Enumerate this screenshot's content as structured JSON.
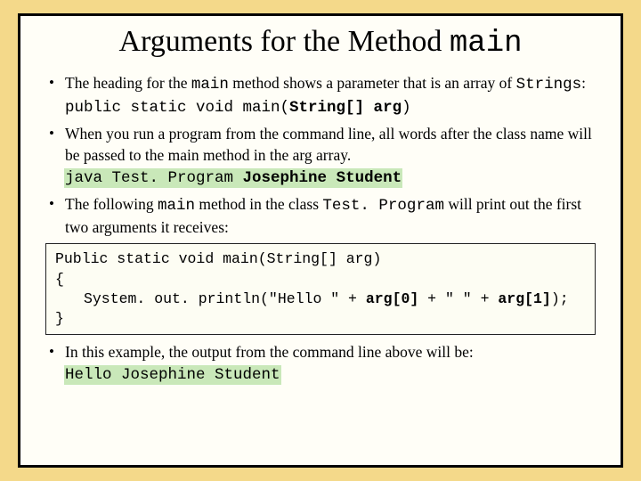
{
  "title_pre": "Arguments for the Method ",
  "title_code": "main",
  "b1_a": "The heading for the ",
  "b1_code1": "main",
  "b1_b": " method shows a parameter that is an array of ",
  "b1_code2": "Strings",
  "b1_c": ":",
  "b1_line_pre": "public static void main(",
  "b1_line_bold": "String[] arg",
  "b1_line_post": ")",
  "b2": "When you run a program from the command line, all words after the class name will be passed to the main method in the arg array.",
  "b2_cmd_pre": "java Test. Program ",
  "b2_cmd_hl": "Josephine Student",
  "b3_a": "The following ",
  "b3_code1": "main",
  "b3_b": " method in the class ",
  "b3_code2": "Test. Program",
  "b3_c": " will print out the first two arguments it receives:",
  "code_l1": "Public static void main(String[] arg)",
  "code_l2": "{",
  "code_l3_pre": "System. out. println(\"Hello \" + ",
  "code_l3_arg0": "arg[0]",
  "code_l3_mid": " + \" \" + ",
  "code_l3_arg1": "arg[1]",
  "code_l3_post": ");",
  "code_l4": "}",
  "b4": "In this example, the output from the command line above will be:",
  "b4_out": "Hello Josephine Student"
}
